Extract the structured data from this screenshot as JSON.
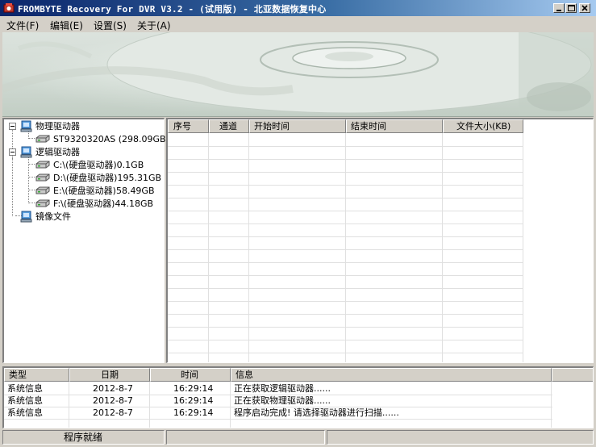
{
  "window": {
    "title": "FROMBYTE Recovery For DVR V3.2 - (试用版) - 北亚数据恢复中心"
  },
  "menu": {
    "items": [
      {
        "label": "文件(F)"
      },
      {
        "label": "编辑(E)"
      },
      {
        "label": "设置(S)"
      },
      {
        "label": "关于(A)"
      }
    ]
  },
  "tree": {
    "physical": {
      "label": "物理驱动器",
      "children": [
        {
          "label": "ST9320320AS (298.09GB)"
        }
      ]
    },
    "logical": {
      "label": "逻辑驱动器",
      "children": [
        {
          "label": "C:\\(硬盘驱动器)0.1GB"
        },
        {
          "label": "D:\\(硬盘驱动器)195.31GB"
        },
        {
          "label": "E:\\(硬盘驱动器)58.49GB"
        },
        {
          "label": "F:\\(硬盘驱动器)44.18GB"
        }
      ]
    },
    "image": {
      "label": "镜像文件"
    }
  },
  "file_list": {
    "columns": [
      "序号",
      "通道",
      "开始时间",
      "结束时间",
      "文件大小(KB)"
    ],
    "rows": []
  },
  "log": {
    "columns": [
      "类型",
      "日期",
      "时间",
      "信息"
    ],
    "rows": [
      {
        "type": "系统信息",
        "date": "2012-8-7",
        "time": "16:29:14",
        "info": "正在获取逻辑驱动器......"
      },
      {
        "type": "系统信息",
        "date": "2012-8-7",
        "time": "16:29:14",
        "info": "正在获取物理驱动器......"
      },
      {
        "type": "系统信息",
        "date": "2012-8-7",
        "time": "16:29:14",
        "info": "程序启动完成! 请选择驱动器进行扫描......"
      }
    ]
  },
  "status": {
    "text": "程序就绪"
  },
  "icons": {
    "app": "app-icon",
    "computer": "computer-icon",
    "drive": "hard-drive-icon",
    "minimize": "minimize-icon",
    "maximize": "maximize-icon",
    "close": "close-icon"
  },
  "colors": {
    "title_start": "#0a246a",
    "title_end": "#a6caf0",
    "face": "#d4d0c8"
  }
}
